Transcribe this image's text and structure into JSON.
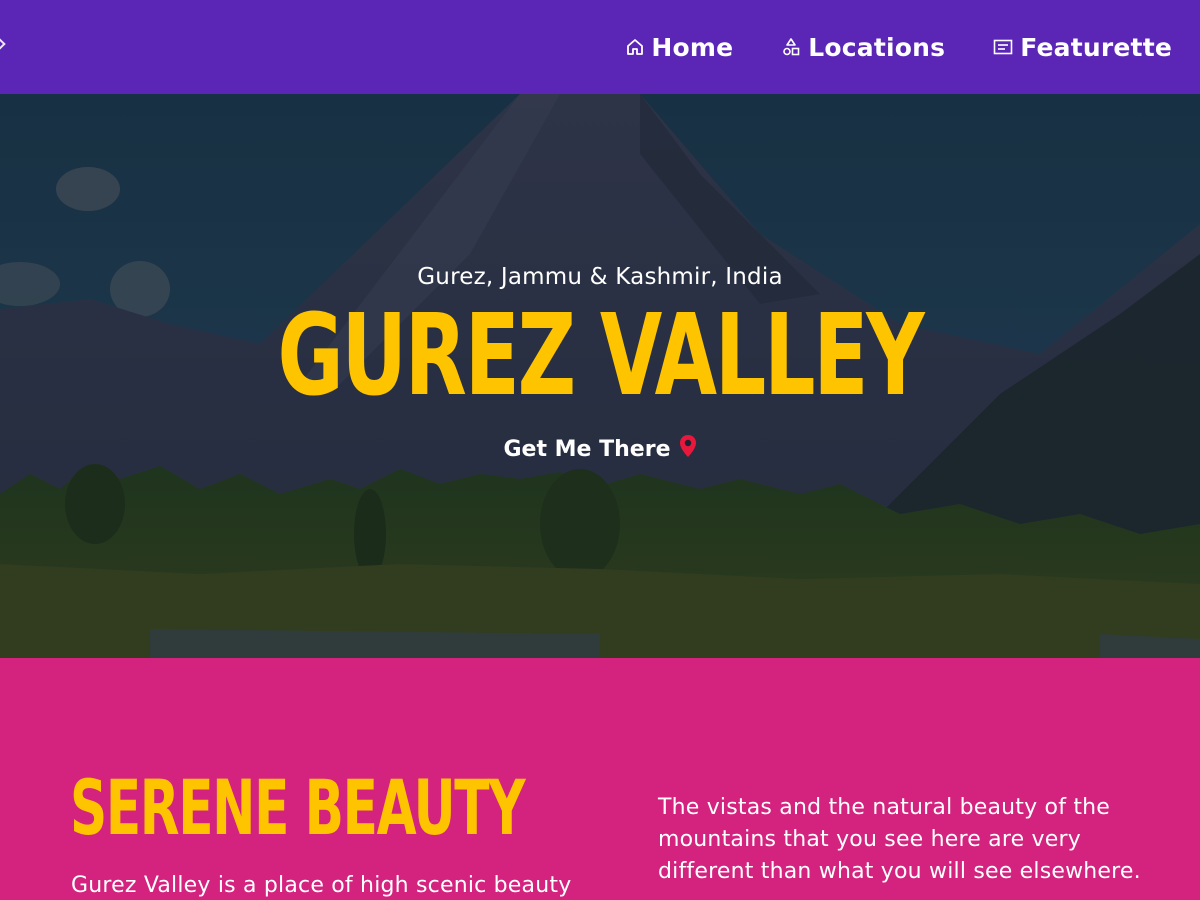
{
  "nav": {
    "items": [
      {
        "label": "Home",
        "icon": "home-icon"
      },
      {
        "label": "Locations",
        "icon": "shapes-icon"
      },
      {
        "label": "Featurette",
        "icon": "newspaper-icon"
      }
    ],
    "partial_icon": "info-icon"
  },
  "hero": {
    "subtitle": "Gurez, Jammu & Kashmir, India",
    "title": "GUREZ VALLEY",
    "cta_label": "Get Me There",
    "cta_icon": "map-pin-icon"
  },
  "section": {
    "title": "SERENE BEAUTY",
    "left_text": "Gurez Valley is a place of high scenic beauty",
    "right_text": "The vistas and the natural beauty of the mountains that you see here are very different than what you will see elsewhere."
  },
  "colors": {
    "nav_bg": "#5b25b6",
    "accent_yellow": "#ffc400",
    "section_bg": "#d4237f",
    "pin_red": "#e8173c"
  }
}
